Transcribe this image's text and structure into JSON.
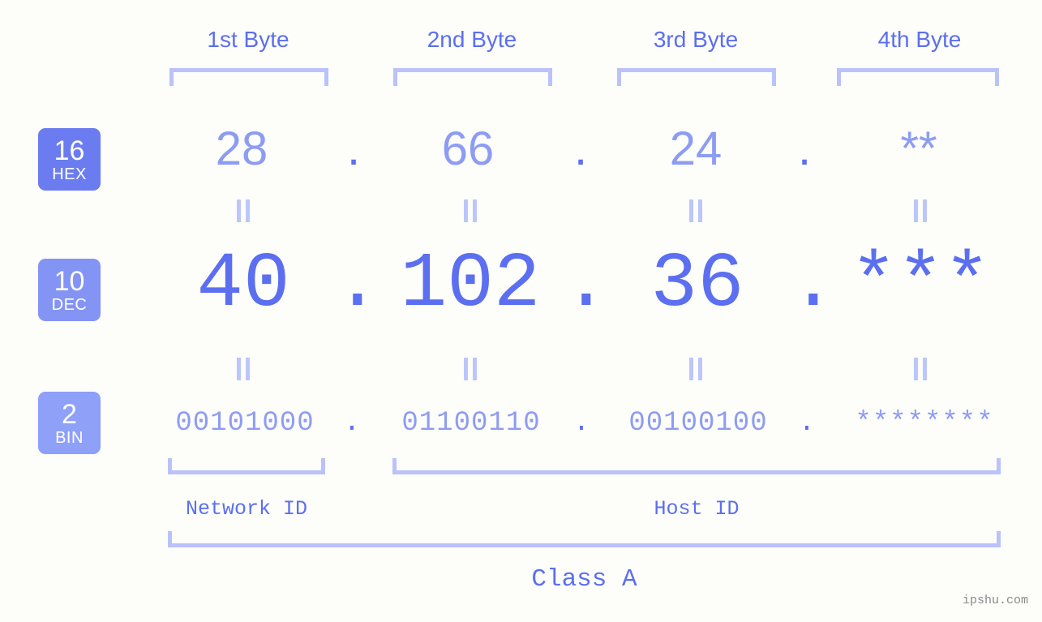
{
  "headers": [
    {
      "label": "1st Byte"
    },
    {
      "label": "2nd Byte"
    },
    {
      "label": "3rd Byte"
    },
    {
      "label": "4th Byte"
    }
  ],
  "bases": [
    {
      "num": "16",
      "name": "HEX",
      "color": "#6b7cf0"
    },
    {
      "num": "10",
      "name": "DEC",
      "color": "#8494f4"
    },
    {
      "num": "2",
      "name": "BIN",
      "color": "#8fa0f8"
    }
  ],
  "separator": ".",
  "rows": {
    "hex": {
      "base": "16",
      "name": "HEX",
      "values": [
        "28",
        "66",
        "24",
        "**"
      ]
    },
    "dec": {
      "base": "10",
      "name": "DEC",
      "values": [
        "40",
        "102",
        "36",
        "***"
      ]
    },
    "bin": {
      "base": "2",
      "name": "BIN",
      "values": [
        "00101000",
        "01100110",
        "00100100",
        "********"
      ]
    }
  },
  "equals_glyph": "=",
  "segments": {
    "network_id": "Network ID",
    "host_id": "Host ID",
    "class": "Class A"
  },
  "watermark": "ipshu.com",
  "colors": {
    "background": "#fdfdfa",
    "accent": "#5b6ff0",
    "accent_light": "#8d9cf3",
    "bracket": "#b9c2fb",
    "watermark": "#8a8a8a"
  }
}
